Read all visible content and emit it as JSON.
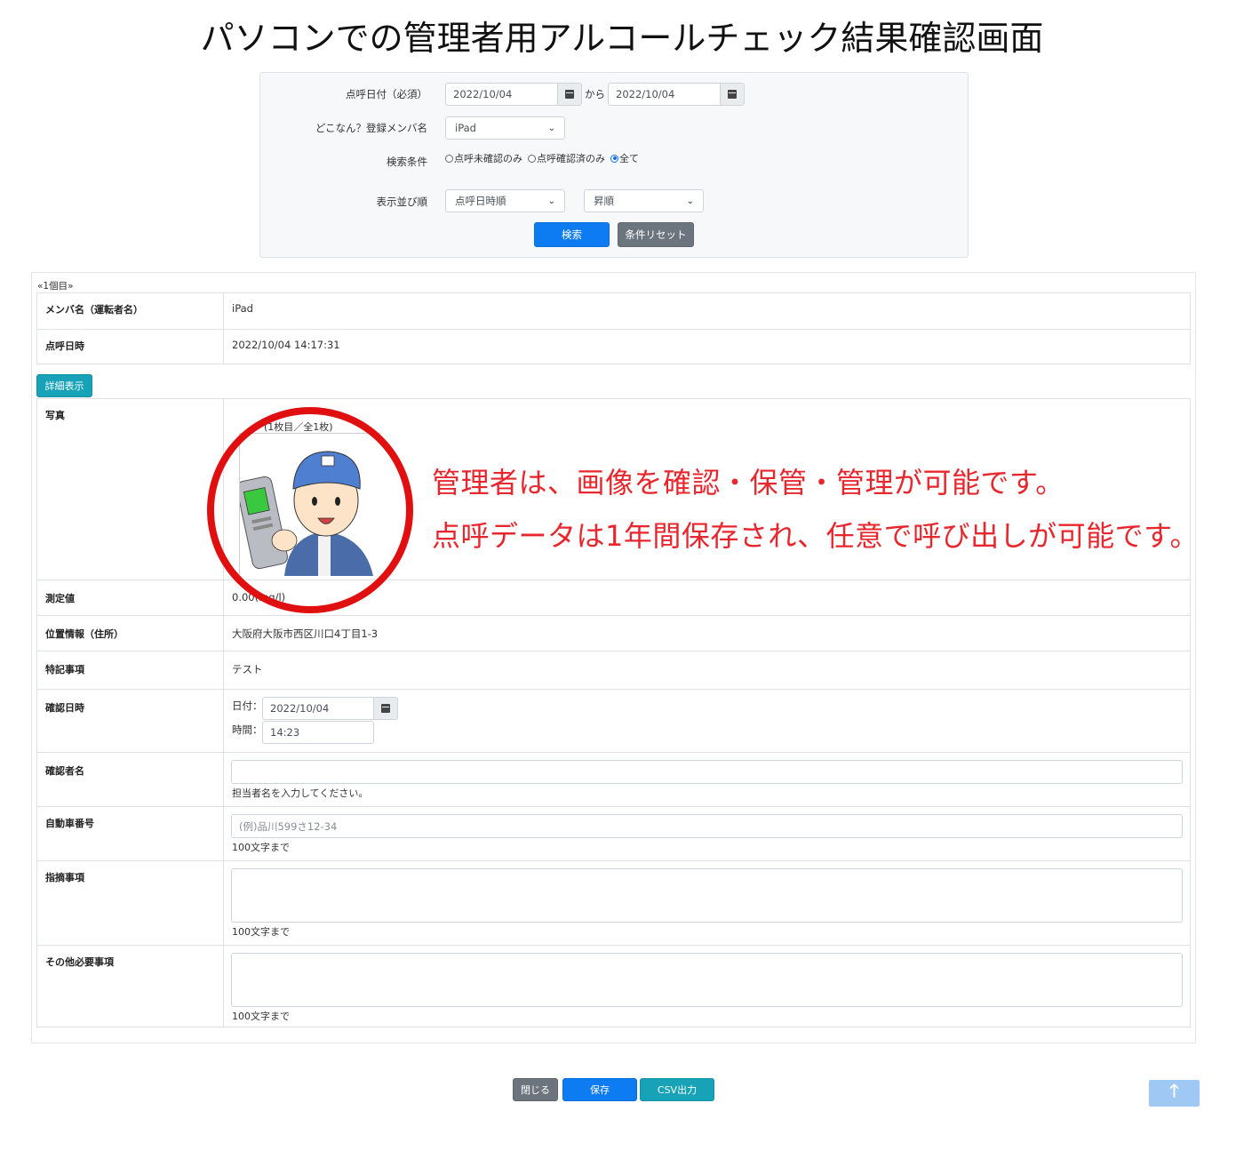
{
  "page_title": "パソコンでの管理者用アルコールチェック結果確認画面",
  "search": {
    "date_label": "点呼日付（必須）",
    "date_from": "2022/10/04",
    "date_sep": "から",
    "date_to": "2022/10/04",
    "member_label": "どこなん？登録メンバ名",
    "member_selected": "iPad",
    "condition_label": "検索条件",
    "condition_options": [
      "点呼未確認のみ",
      "点呼確認済のみ",
      "全て"
    ],
    "condition_selected_index": 2,
    "sort_label": "表示並び順",
    "sort_field": "点呼日時順",
    "sort_order": "昇順",
    "search_button": "検索",
    "reset_button": "条件リセット"
  },
  "result": {
    "pager": "«1個目»",
    "member_label": "メンバ名（運転者名）",
    "member_value": "iPad",
    "call_time_label": "点呼日時",
    "call_time_value": "2022/10/04 14:17:31",
    "detail_button": "詳細表示",
    "photo_label": "写真",
    "photo_caption": "(1枚目／全1枚)",
    "measure_label": "測定値",
    "measure_value": "0.00(mg/l)",
    "location_label": "位置情報（住所）",
    "location_value": "大阪府大阪市西区川口4丁目1-3",
    "notes_label": "特記事項",
    "notes_value": "テスト",
    "confirm_time_label": "確認日時",
    "confirm_date_prefix": "日付：",
    "confirm_date_value": "2022/10/04",
    "confirm_time_prefix": "時間：",
    "confirm_time_value": "14:23",
    "confirmer_label": "確認者名",
    "confirmer_value": "",
    "confirmer_help": "担当者名を入力してください。",
    "car_label": "自動車番号",
    "car_placeholder": "(例)品川599さ12-34",
    "car_help": "100文字まで",
    "instruction_label": "指摘事項",
    "instruction_help": "100文字まで",
    "other_label": "その他必要事項",
    "other_help": "100文字まで"
  },
  "annotation": {
    "line1": "管理者は、画像を確認・保管・管理が可能です。",
    "line2": "点呼データは1年間保存され、任意で呼び出しが可能です。",
    "color": "#e8262d"
  },
  "footer": {
    "close_button": "閉じる",
    "save_button": "保存",
    "csv_button": "CSV出力"
  }
}
